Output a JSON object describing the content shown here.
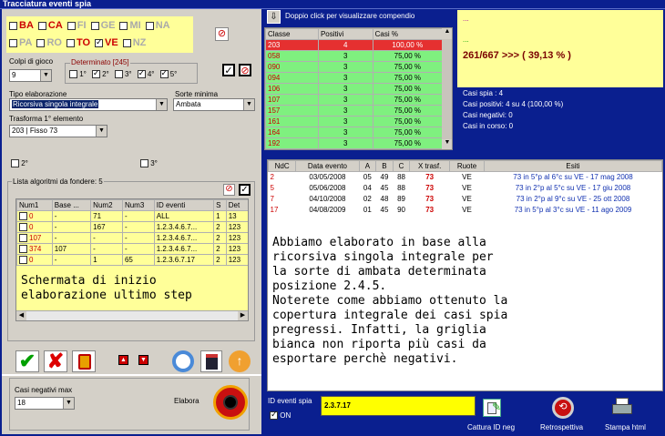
{
  "title": "Tracciatura eventi spia",
  "ruote_row1": [
    {
      "label": "BA",
      "on": false,
      "red": true
    },
    {
      "label": "CA",
      "on": false,
      "red": true
    },
    {
      "label": "FI",
      "on": false,
      "red": false
    },
    {
      "label": "GE",
      "on": false,
      "red": false
    },
    {
      "label": "MI",
      "on": false,
      "red": false
    },
    {
      "label": "NA",
      "on": false,
      "red": false
    }
  ],
  "ruote_row2": [
    {
      "label": "PA",
      "on": false,
      "red": false
    },
    {
      "label": "RO",
      "on": false,
      "red": false
    },
    {
      "label": "TO",
      "on": false,
      "red": true
    },
    {
      "label": "VE",
      "on": true,
      "red": true
    },
    {
      "label": "NZ",
      "on": false,
      "red": false
    }
  ],
  "colpi_label": "Colpi di gioco",
  "colpi_value": "9",
  "determinato_label": "Determinato [245]",
  "positions": [
    {
      "label": "1°",
      "on": false
    },
    {
      "label": "2°",
      "on": true
    },
    {
      "label": "3°",
      "on": false
    },
    {
      "label": "4°",
      "on": true
    },
    {
      "label": "5°",
      "on": true
    }
  ],
  "tipo_label": "Tipo elaborazione",
  "tipo_value": "Ricorsiva singola integrale",
  "sorte_label": "Sorte minima",
  "sorte_value": "Ambata",
  "trasforma_label": "Trasforma 1° elemento",
  "trasforma_value": "203 | Fisso 73",
  "chk2": "2°",
  "chk3": "3°",
  "lista_label": "Lista algoritmi da fondere: 5",
  "alg_headers": [
    "Num1",
    "Base ...",
    "Num2",
    "Num3",
    "ID eventi",
    "S",
    "Det"
  ],
  "alg_rows": [
    [
      "0",
      "-",
      "71",
      "-",
      "ALL",
      "1",
      "13"
    ],
    [
      "0",
      "-",
      "167",
      "-",
      "1.2.3.4.6.7...",
      "2",
      "123"
    ],
    [
      "107",
      "-",
      "-",
      "-",
      "1.2.3.4.6.7...",
      "2",
      "123"
    ],
    [
      "374",
      "107",
      "-",
      "-",
      "1.2.3.4.6.7...",
      "2",
      "123"
    ],
    [
      "0",
      "-",
      "1",
      "65",
      "1.2.3.6.7.17",
      "2",
      "123"
    ]
  ],
  "alg_overlay": "Schermata di inizio\nelaborazione ultimo step",
  "casi_neg_label": "Casi negativi max",
  "casi_neg_value": "18",
  "elabora_label": "Elabora",
  "doppio_click": "Doppio click per visualizzare compendio",
  "classe_headers": [
    "Classe",
    "Positivi",
    "Casi %"
  ],
  "classe_rows": [
    [
      "203",
      "4",
      "100,00 %"
    ],
    [
      "058",
      "3",
      "75,00 %"
    ],
    [
      "090",
      "3",
      "75,00 %"
    ],
    [
      "094",
      "3",
      "75,00 %"
    ],
    [
      "106",
      "3",
      "75,00 %"
    ],
    [
      "107",
      "3",
      "75,00 %"
    ],
    [
      "157",
      "3",
      "75,00 %"
    ],
    [
      "161",
      "3",
      "75,00 %"
    ],
    [
      "164",
      "3",
      "75,00 %"
    ],
    [
      "192",
      "3",
      "75,00 %"
    ]
  ],
  "dots1": "...",
  "dots2": "...",
  "summary": "261/667 >>> ( 39,13 % )",
  "casi_spia": "Casi spia : 4",
  "casi_positivi": "Casi positivi: 4 su 4 (100,00 %)",
  "casi_negativi": "Casi negativi: 0",
  "casi_corso": "Casi in corso: 0",
  "eventi_headers": [
    "NdC",
    "Data evento",
    "A",
    "B",
    "C",
    "X trasf.",
    "Ruote",
    "Esiti"
  ],
  "eventi_rows": [
    [
      "2",
      "03/05/2008",
      "05",
      "49",
      "88",
      "73",
      "VE",
      "73 in 5°p al 6°c su VE - 17 mag 2008"
    ],
    [
      "5",
      "05/06/2008",
      "04",
      "45",
      "88",
      "73",
      "VE",
      "73 in 2°p al 5°c su VE - 17 giu 2008"
    ],
    [
      "7",
      "04/10/2008",
      "02",
      "48",
      "89",
      "73",
      "VE",
      "73 in 2°p al 9°c su VE - 25 ott 2008"
    ],
    [
      "17",
      "04/08/2009",
      "01",
      "45",
      "90",
      "73",
      "VE",
      "73 in 5°p al 3°c su VE - 11 ago 2009"
    ]
  ],
  "note": "Abbiamo elaborato in base alla\nricorsiva singola integrale per\nla sorte di ambata determinata\nposizione 2.4.5.\nNoterete come abbiamo ottenuto la\ncopertura integrale dei casi spia\npregressi. Infatti, la griglia\nbianca non riporta più casi da\nesportare perchè negativi.",
  "id_eventi_label": "ID eventi spia",
  "id_eventi_value": "2.3.7.17",
  "on_label": "ON",
  "cattura_label": "Cattura ID neg",
  "retro_label": "Retrospettiva",
  "stampa_label": "Stampa html",
  "colors": {
    "bg": "#0a1f8f",
    "panel": "#d4d0c8",
    "green": "#7ff07f",
    "yellow": "#ffff99",
    "summary_text": "#7a0000"
  }
}
